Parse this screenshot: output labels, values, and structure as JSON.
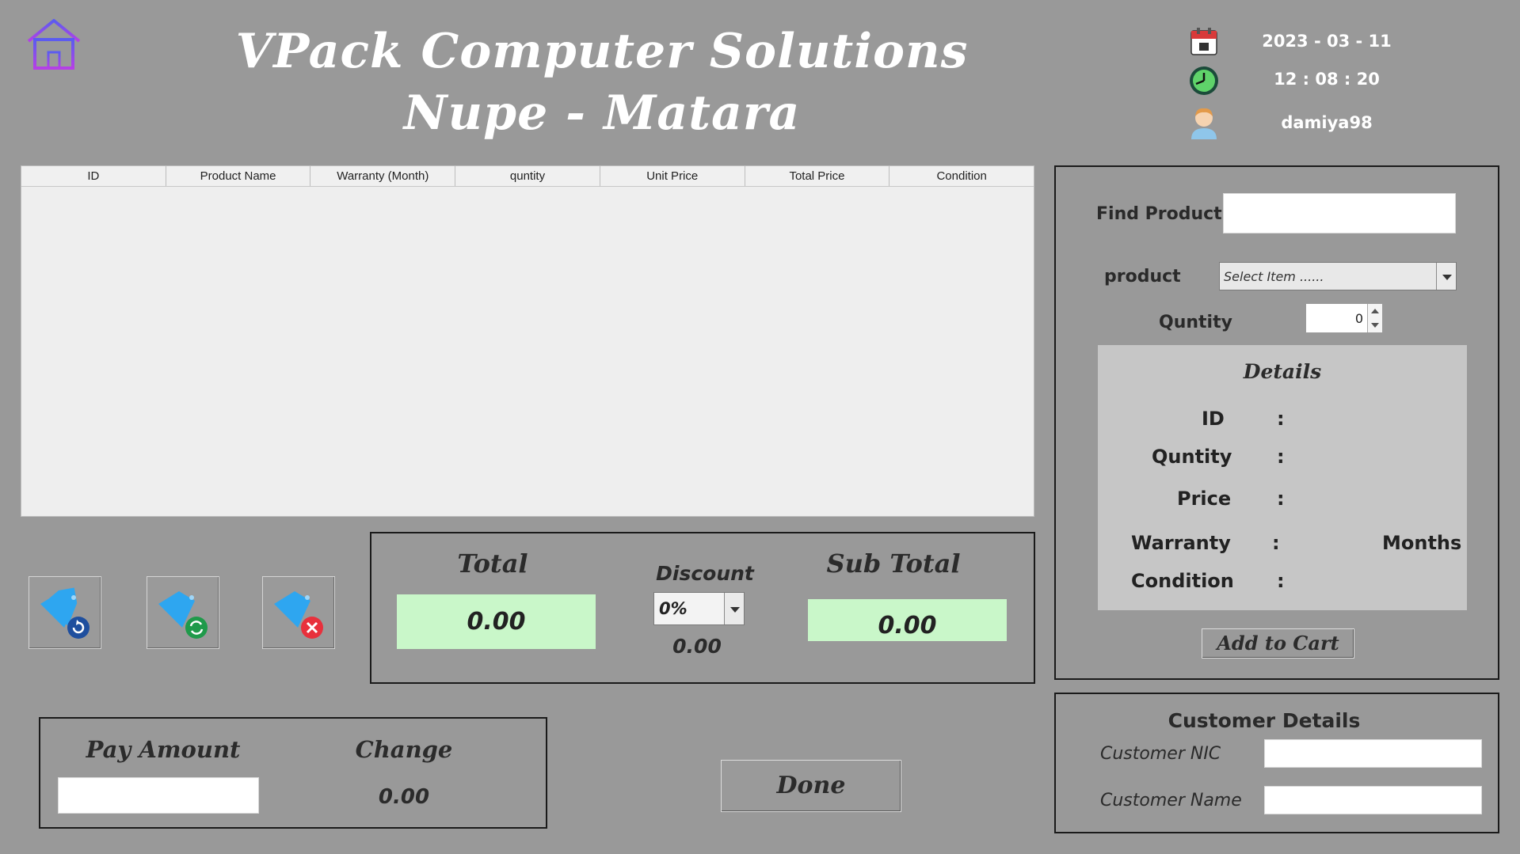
{
  "header": {
    "title_line1": "VPack Computer Solutions",
    "title_line2": "Nupe - Matara",
    "date": "2023 - 03 - 11",
    "time": "12 : 08 : 20",
    "user": "damiya98"
  },
  "icons": {
    "home": "home-icon",
    "date": "calendar-icon",
    "time": "clock-icon",
    "user": "user-icon"
  },
  "table": {
    "columns": [
      "ID",
      "Product Name",
      "Warranty (Month)",
      "quntity",
      "Unit Price",
      "Total Price",
      "Condition"
    ],
    "rows": []
  },
  "totals": {
    "total_label": "Total",
    "total_value": "0.00",
    "discount_label": "Discount",
    "discount_selected": "0%",
    "discount_amount": "0.00",
    "subtotal_label": "Sub Total",
    "subtotal_value": "0.00"
  },
  "payment": {
    "pay_amount_label": "Pay Amount",
    "pay_amount_value": "",
    "change_label": "Change",
    "change_value": "0.00"
  },
  "done_label": "Done",
  "product_panel": {
    "find_label": "Find Product",
    "find_value": "",
    "product_label": "product",
    "product_placeholder": "Select Item ......",
    "quantity_label": "Quntity",
    "quantity_value": "0",
    "details": {
      "title": "Details",
      "id_label": "ID",
      "quantity_label": "Quntity",
      "price_label": "Price",
      "warranty_label": "Warranty",
      "warranty_unit": "Months",
      "condition_label": "Condition",
      "colon": ":"
    },
    "add_to_cart_label": "Add to Cart"
  },
  "customer": {
    "title": "Customer Details",
    "nic_label": "Customer NIC",
    "nic_value": "",
    "name_label": "Customer Name",
    "name_value": ""
  },
  "colors": {
    "background": "#999999",
    "green_field": "#c9f7c9",
    "tag_blue": "#2ea6f0",
    "refresh_dark_blue": "#1f4f9e",
    "refresh_green": "#1f9a4a",
    "delete_red": "#e8303c"
  }
}
